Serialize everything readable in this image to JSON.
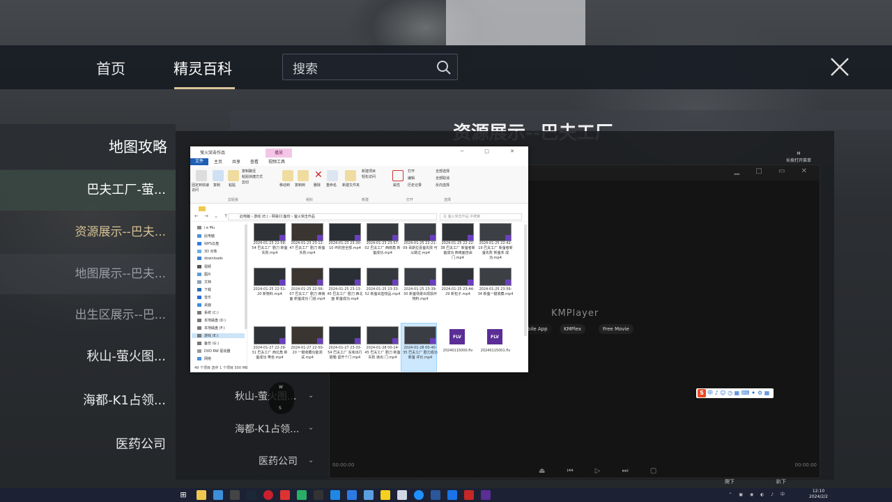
{
  "topnav": {
    "tabs": [
      {
        "label": "首页"
      },
      {
        "label": "精灵百科"
      }
    ],
    "search_placeholder": "搜索"
  },
  "page_title": "资源展示--巴夫工厂",
  "sidebar": {
    "header": "地图攻略",
    "items": [
      {
        "label": "巴夫工厂-萤..."
      },
      {
        "label": "秋山-萤火图..."
      },
      {
        "label": "海都-K1占领..."
      },
      {
        "label": "医药公司"
      }
    ],
    "subitems": [
      {
        "label": "资源展示--巴夫..."
      },
      {
        "label": "地图展示--巴夫..."
      },
      {
        "label": "出生区展示--巴..."
      }
    ]
  },
  "overlay_menu": [
    {
      "label": "秋山-萤火图..."
    },
    {
      "label": "海都-K1占领..."
    },
    {
      "label": "医药公司"
    }
  ],
  "kmplayer": {
    "logo": "KMPlayer",
    "apps": [
      "bile App",
      "KMPlex",
      "Free Movie"
    ],
    "time_left": "00:00:00",
    "time_right": "00:00:00",
    "hint_top": "M",
    "hint_bottom": "长按打开菜单",
    "bottom_left": "爬下",
    "bottom_right": "趴下"
  },
  "ime": {
    "glyph": "S",
    "text": "中 ♪ ☺ ◷ ▦ ⌨ ✦ ⚙ ▦"
  },
  "explorer": {
    "title": "萤火突击作品",
    "context_tab": "播放",
    "tabs": [
      "文件",
      "主页",
      "共享",
      "查看",
      "视频工具"
    ],
    "ribbon": {
      "buttons": [
        "固定到快速访问",
        "复制",
        "粘贴",
        "剪切",
        "复制路径",
        "粘贴快捷方式",
        "移动到",
        "复制到",
        "删除",
        "重命名",
        "新建文件夹",
        "新建项目",
        "轻松访问",
        "属性",
        "打开",
        "编辑",
        "历史记录",
        "全部选择",
        "全部取消",
        "反向选择"
      ],
      "groups": [
        "剪贴板",
        "组织",
        "新建",
        "打开",
        "选择"
      ]
    },
    "address": "此电脑 › 游戏 (E:) › 网易CC备份 › 萤火突击作品",
    "search_placeholder": "在 萤火突击作品 中搜索",
    "nav": [
      "i.e Mu",
      "此电脑",
      "WPS云盘",
      "3D 对象",
      "downloads",
      "视频",
      "图片",
      "文档",
      "下载",
      "音乐",
      "桌面",
      "系统 (C:)",
      "本地磁盘 (D:)",
      "本地磁盘 (F:)",
      "游戏 (E:)",
      "备份 (G:)",
      "DVD RW 驱动器",
      "网络"
    ],
    "files_row1": [
      "2024-01-23 22-59-54 巴夫工厂 剧刀 新萤失败.mp4",
      "2024-01-23 23-12-47 巴夫工厂 剧刀 新萤失败.mp4",
      "2024-01-23 23-30-10 坏的挂全部.mp4",
      "2024-01-23 23-57-02 巴夫工厂 西南角 新萤成功.mp4",
      "2024-01-25 22-21-09 哥斯拉喜萤失败 可以跳过.mp4",
      "2024-01-25 22-22-38 巴夫工厂 新萤者新萤成功 西南面自由门.mp4",
      "2024-01-25 22-42-19 巴夫工厂 新萤者新萤失败 新萤未 成功.mp4"
    ],
    "files_row2": [
      "2024-01-25 22-51-20 新物料.mp4",
      "2024-01-25 22-56-07 巴夫工厂 剧刀 西南面 新萤成功 门道.mp4",
      "2024-01-25 23-13-45 巴夫工厂 剧刀 西北面 新萤成功.mp4",
      "2024-01-25 23-33-52 新萤出售物品.mp4",
      "2024-01-25 23-39-30 新萤场景出现损坏物料.mp4",
      "2024-01-25 23-44-29 新包子.mp4",
      "2024-01-25 23-56-34 新萤一键收藏.mp4"
    ],
    "files_row3": [
      "2024-01-27 22-29-31 巴夫工厂 西北角 新萤成功 带坐.mp4",
      "2024-01-27 22-50-20 一键收藏功能测试.mp4",
      "2024-01-27 23-33-54 巴夫工厂 车库出行 砸箱 留开个门.mp4",
      "2024-01-28 00-14-45 巴夫工厂 剧刀 新萤失败 抛出 门.mp4",
      "2024-01-28 00-40-35 巴夫工厂 剧刀成功 新萤 评价.mp4",
      "20240115000.flv",
      "20240115001.flv"
    ],
    "status": "49 个项目   选中 1 个项目 500 MB"
  },
  "taskbar": {
    "time": "12:10",
    "date": "2024/2/2"
  }
}
